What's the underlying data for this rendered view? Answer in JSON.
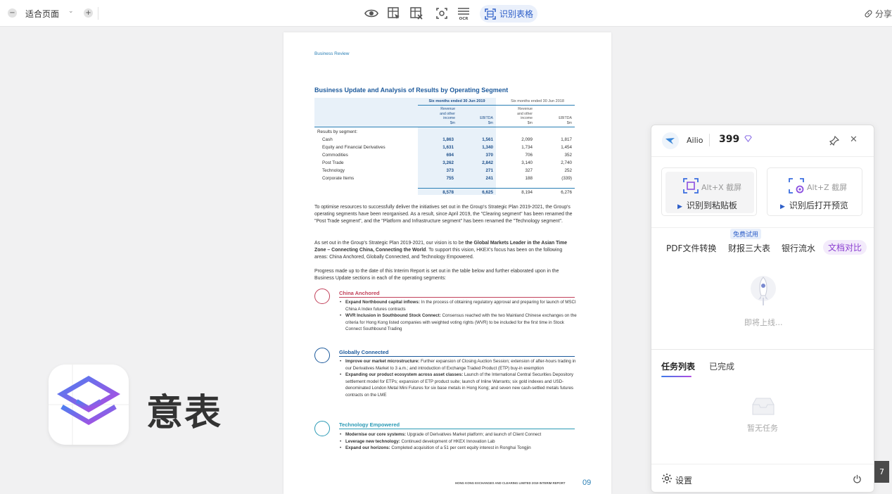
{
  "toolbar": {
    "zoom_out": "−",
    "zoom_label": "适合页面",
    "zoom_dropdown": "⌄",
    "zoom_in": "+",
    "recognize_table": "识别表格",
    "share": "分享"
  },
  "document": {
    "section": "Business Review",
    "heading": "Business Update and Analysis of Results by Operating Segment",
    "table": {
      "group1": "Six months ended 30 Jun 2019",
      "group2": "Six months ended 30 Jun 2018",
      "col_revenue": [
        "Revenue",
        "and other",
        "income",
        "$m"
      ],
      "col_ebitda": [
        "EBITDA",
        "$m"
      ],
      "section_label": "Results by segment:",
      "rows": [
        {
          "name": "Cash",
          "v1": "1,863",
          "v2": "1,561",
          "v3": "2,099",
          "v4": "1,817"
        },
        {
          "name": "Equity and Financial Derivatives",
          "v1": "1,631",
          "v2": "1,340",
          "v3": "1,734",
          "v4": "1,454"
        },
        {
          "name": "Commodities",
          "v1": "694",
          "v2": "370",
          "v3": "706",
          "v4": "352"
        },
        {
          "name": "Post Trade",
          "v1": "3,262",
          "v2": "2,842",
          "v3": "3,140",
          "v4": "2,740"
        },
        {
          "name": "Technology",
          "v1": "373",
          "v2": "271",
          "v3": "327",
          "v4": "252"
        },
        {
          "name": "Corporate Items",
          "v1": "755",
          "v2": "241",
          "v3": "188",
          "v4": "(339)"
        }
      ],
      "total": {
        "v1": "8,578",
        "v2": "6,625",
        "v3": "8,194",
        "v4": "6,276"
      }
    },
    "para1": "To optimise resources to successfully deliver the initiatives set out in the Group's Strategic Plan 2019-2021, the Group's operating segments have been reorganised. As a result, since April 2019, the \"Clearing segment\" has been renamed the \"Post Trade segment\", and the \"Platform and Infrastructure segment\" has been renamed the \"Technology segment\".",
    "para2_a": "As set out in the Group's Strategic Plan 2019-2021, our vision is to be ",
    "para2_b": "the Global Markets Leader in the Asian Time Zone – Connecting China, Connecting the World",
    "para2_c": ". To support this vision, HKEX's focus has been on the following areas: China Anchored, Globally Connected, and Technology Empowered.",
    "para3": "Progress made up to the date of this Interim Report is set out in the table below and further elaborated upon in the Business Update sections in each of the operating segments:",
    "seg1": {
      "title": "China Anchored",
      "bullets": [
        {
          "b": "Expand Northbound capital inflows:",
          "t": " In the process of obtaining regulatory approval and preparing for launch of MSCI China A Index futures contracts"
        },
        {
          "b": "WVR Inclusion in Southbound Stock Connect:",
          "t": " Consensus reached with the two Mainland Chinese exchanges on the criteria for Hong Kong listed companies with weighted voting rights (WVR) to be included for the first time in Stock Connect Southbound Trading"
        }
      ]
    },
    "seg2": {
      "title": "Globally Connected",
      "bullets": [
        {
          "b": "Improve our market microstructure:",
          "t": " Further expansion of Closing Auction Session; extension of after-hours trading in our Derivatives Market to 3 a.m.; and introduction of Exchange Traded Product (ETP) buy-in exemption"
        },
        {
          "b": "Expanding our product ecosystem across asset classes:",
          "t": " Launch of the International Central Securities Depository settlement model for ETPs; expansion of ETP product suite; launch of Inline Warrants; six gold indexes and USD-denominated London Metal Mini Futures for six base metals in Hong Kong; and seven new cash-settled metals futures contracts on the LME"
        }
      ]
    },
    "seg3": {
      "title": "Technology Empowered",
      "bullets": [
        {
          "b": "Modernise our core systems:",
          "t": " Upgrade of Derivatives Market platform; and launch of Client Connect"
        },
        {
          "b": "Leverage new technology:",
          "t": " Continued development of HKEX Innovation Lab"
        },
        {
          "b": "Expand our horizons:",
          "t": " Completed acquisition of a 51 per cent equity interest in Ronghui Tongjin"
        }
      ]
    },
    "footer": "HONG KONG EXCHANGES AND CLEARING LIMITED   2019 INTERIM REPORT",
    "page_number": "09"
  },
  "brand": {
    "name": "意表"
  },
  "panel": {
    "user": "Ailio",
    "credits": "399",
    "card1": {
      "shortcut": "Alt+X 截屏",
      "action": "识别到粘贴板"
    },
    "card2": {
      "shortcut": "Alt+Z 截屏",
      "action": "识别后打开预览"
    },
    "free_badge": "免费试用",
    "tabs": [
      "PDF文件转换",
      "财报三大表",
      "银行流水",
      "文档对比"
    ],
    "coming_soon": "即将上线...",
    "list_tabs": [
      "任务列表",
      "已完成"
    ],
    "empty": "暂无任务",
    "settings": "设置"
  },
  "pager": "7"
}
